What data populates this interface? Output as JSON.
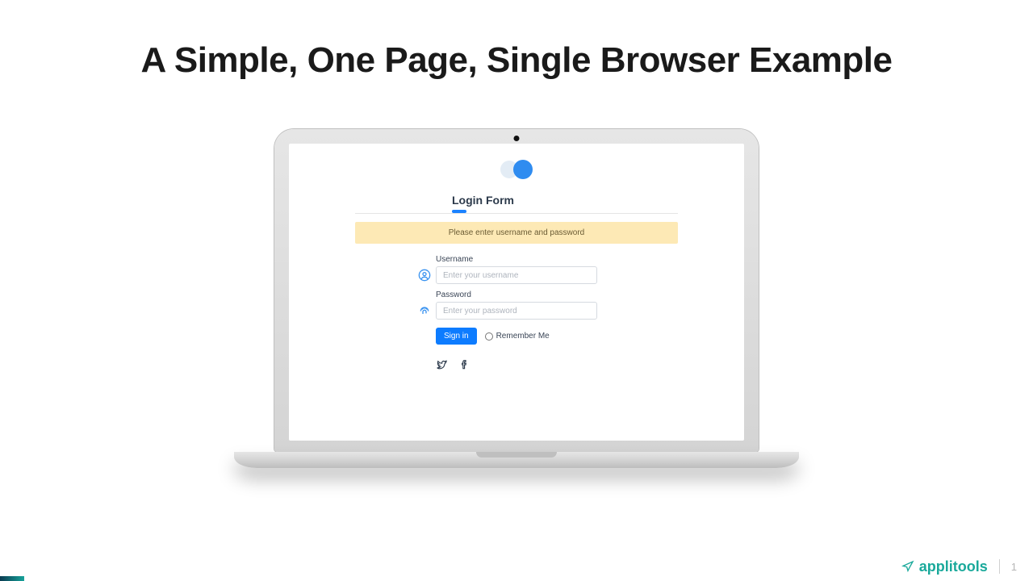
{
  "slide": {
    "title": "A Simple, One Page, Single Browser Example",
    "number": "1"
  },
  "brand": {
    "name": "applitools"
  },
  "login": {
    "form_title": "Login Form",
    "alert": "Please enter username and password",
    "username_label": "Username",
    "username_placeholder": "Enter your username",
    "password_label": "Password",
    "password_placeholder": "Enter your password",
    "signin_label": "Sign in",
    "remember_label": "Remember Me"
  }
}
